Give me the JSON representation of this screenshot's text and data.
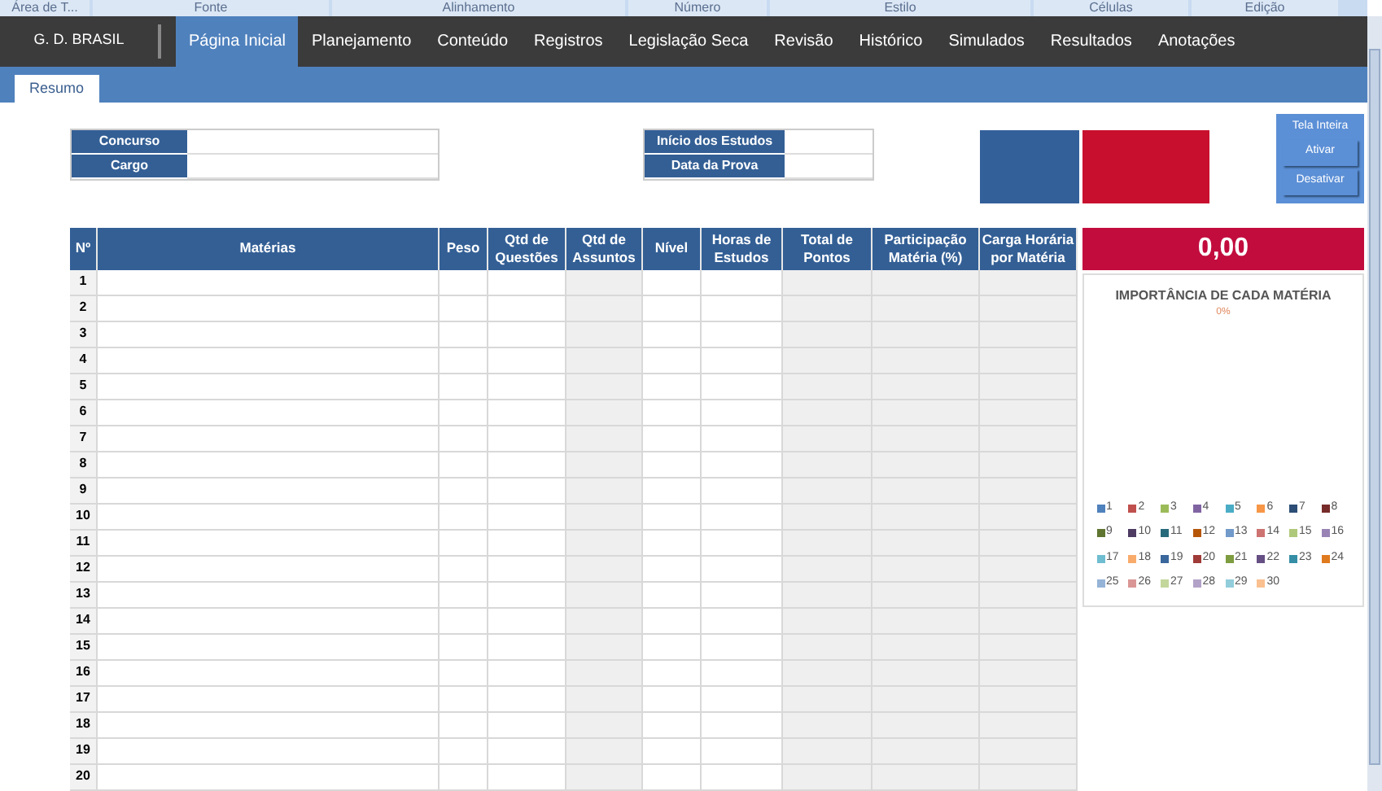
{
  "ribbon_groups": [
    "Área de T...",
    "Fonte",
    "Alinhamento",
    "Número",
    "Estilo",
    "Células",
    "Edição"
  ],
  "brand": "G. D. BRASIL",
  "nav": [
    {
      "label": "Página Inicial",
      "selected": true
    },
    {
      "label": "Planejamento",
      "selected": false
    },
    {
      "label": "Conteúdo",
      "selected": false
    },
    {
      "label": "Registros",
      "selected": false
    },
    {
      "label": "Legislação Seca",
      "selected": false
    },
    {
      "label": "Revisão",
      "selected": false
    },
    {
      "label": "Histórico",
      "selected": false
    },
    {
      "label": "Simulados",
      "selected": false
    },
    {
      "label": "Resultados",
      "selected": false
    },
    {
      "label": "Anotações",
      "selected": false
    }
  ],
  "sheet_tab": "Resumo",
  "info_fields": [
    {
      "label": "Concurso"
    },
    {
      "label": "Cargo"
    }
  ],
  "date_fields": [
    {
      "label": "Início dos Estudos"
    },
    {
      "label": "Data da Prova"
    }
  ],
  "fullscreen": {
    "title": "Tela Inteira",
    "buttons": [
      "Ativar",
      "Desativar"
    ]
  },
  "table": {
    "columns": [
      "Nº",
      "Matérias",
      "Peso",
      "Qtd de Questões",
      "Qtd de Assuntos",
      "Nível",
      "Horas de Estudos",
      "Total de Pontos",
      "Participação Matéria (%)",
      "Carga Horária por Matéria"
    ],
    "rows": [
      "1",
      "2",
      "3",
      "4",
      "5",
      "6",
      "7",
      "8",
      "9",
      "10",
      "11",
      "12",
      "13",
      "14",
      "15",
      "16",
      "17",
      "18",
      "19",
      "20"
    ]
  },
  "total": "0,00",
  "chart": {
    "title": "IMPORTÂNCIA DE CADA MATÉRIA",
    "subtitle": "0%",
    "legend": [
      {
        "label": "1",
        "color": "#4f81bd"
      },
      {
        "label": "2",
        "color": "#c0504d"
      },
      {
        "label": "3",
        "color": "#9bbb59"
      },
      {
        "label": "4",
        "color": "#8064a2"
      },
      {
        "label": "5",
        "color": "#4bacc6"
      },
      {
        "label": "6",
        "color": "#f79646"
      },
      {
        "label": "7",
        "color": "#2c4d75"
      },
      {
        "label": "8",
        "color": "#772c2a"
      },
      {
        "label": "9",
        "color": "#5f7530"
      },
      {
        "label": "10",
        "color": "#4d3b62"
      },
      {
        "label": "11",
        "color": "#276a7c"
      },
      {
        "label": "12",
        "color": "#b65708"
      },
      {
        "label": "13",
        "color": "#729aca"
      },
      {
        "label": "14",
        "color": "#cd7371"
      },
      {
        "label": "15",
        "color": "#afc97a"
      },
      {
        "label": "16",
        "color": "#9983b5"
      },
      {
        "label": "17",
        "color": "#6fbdd1"
      },
      {
        "label": "18",
        "color": "#f9ab6b"
      },
      {
        "label": "19",
        "color": "#3a679c"
      },
      {
        "label": "20",
        "color": "#9f3b38"
      },
      {
        "label": "21",
        "color": "#7e9c40"
      },
      {
        "label": "22",
        "color": "#664f83"
      },
      {
        "label": "23",
        "color": "#358ea6"
      },
      {
        "label": "24",
        "color": "#e07a1e"
      },
      {
        "label": "25",
        "color": "#95b3d7"
      },
      {
        "label": "26",
        "color": "#d99694"
      },
      {
        "label": "27",
        "color": "#c3d69b"
      },
      {
        "label": "28",
        "color": "#b2a2c7"
      },
      {
        "label": "29",
        "color": "#92cddc"
      },
      {
        "label": "30",
        "color": "#fac090"
      }
    ]
  }
}
